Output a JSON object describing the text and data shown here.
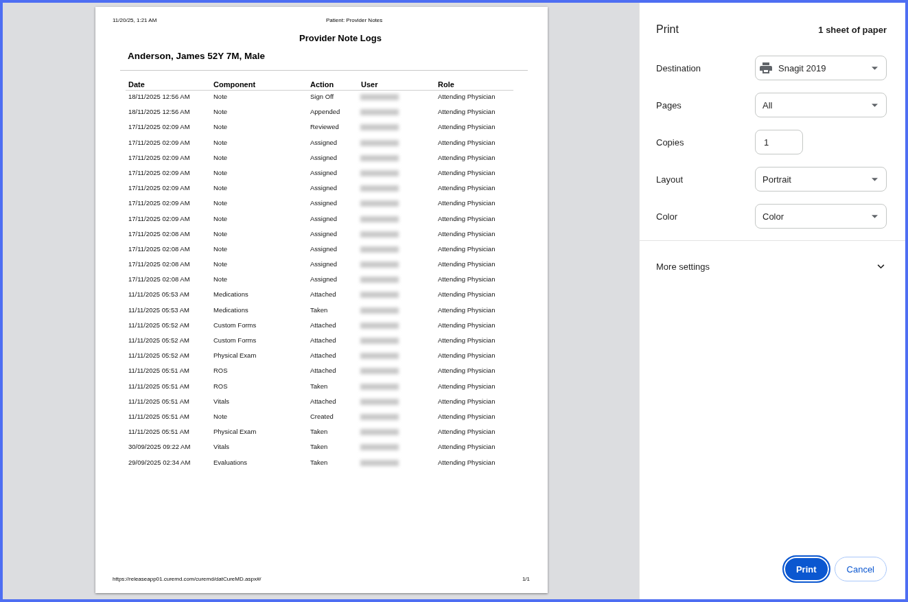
{
  "print_preview": {
    "page": {
      "header_date": "11/20/25, 1:21 AM",
      "header_title": "Patient: Provider Notes",
      "title": "Provider Note Logs",
      "patient": "Anderson, James 52Y 7M, Male",
      "table": {
        "columns": [
          "Date",
          "Component",
          "Action",
          "User",
          "Role"
        ],
        "rows": [
          {
            "date": "18/11/2025 12:56 AM",
            "component": "Note",
            "action": "Sign Off",
            "role": "Attending Physician"
          },
          {
            "date": "18/11/2025 12:56 AM",
            "component": "Note",
            "action": "Appended",
            "role": "Attending Physician"
          },
          {
            "date": "17/11/2025 02:09 AM",
            "component": "Note",
            "action": "Reviewed",
            "role": "Attending Physician"
          },
          {
            "date": "17/11/2025 02:09 AM",
            "component": "Note",
            "action": "Assigned",
            "role": "Attending Physician"
          },
          {
            "date": "17/11/2025 02:09 AM",
            "component": "Note",
            "action": "Assigned",
            "role": "Attending Physician"
          },
          {
            "date": "17/11/2025 02:09 AM",
            "component": "Note",
            "action": "Assigned",
            "role": "Attending Physician"
          },
          {
            "date": "17/11/2025 02:09 AM",
            "component": "Note",
            "action": "Assigned",
            "role": "Attending Physician"
          },
          {
            "date": "17/11/2025 02:09 AM",
            "component": "Note",
            "action": "Assigned",
            "role": "Attending Physician"
          },
          {
            "date": "17/11/2025 02:09 AM",
            "component": "Note",
            "action": "Assigned",
            "role": "Attending Physician"
          },
          {
            "date": "17/11/2025 02:08 AM",
            "component": "Note",
            "action": "Assigned",
            "role": "Attending Physician"
          },
          {
            "date": "17/11/2025 02:08 AM",
            "component": "Note",
            "action": "Assigned",
            "role": "Attending Physician"
          },
          {
            "date": "17/11/2025 02:08 AM",
            "component": "Note",
            "action": "Assigned",
            "role": "Attending Physician"
          },
          {
            "date": "17/11/2025 02:08 AM",
            "component": "Note",
            "action": "Assigned",
            "role": "Attending Physician"
          },
          {
            "date": "11/11/2025 05:53 AM",
            "component": "Medications",
            "action": "Attached",
            "role": "Attending Physician"
          },
          {
            "date": "11/11/2025 05:53 AM",
            "component": "Medications",
            "action": "Taken",
            "role": "Attending Physician"
          },
          {
            "date": "11/11/2025 05:52 AM",
            "component": "Custom Forms",
            "action": "Attached",
            "role": "Attending Physician"
          },
          {
            "date": "11/11/2025 05:52 AM",
            "component": "Custom Forms",
            "action": "Attached",
            "role": "Attending Physician"
          },
          {
            "date": "11/11/2025 05:52 AM",
            "component": "Physical Exam",
            "action": "Attached",
            "role": "Attending Physician"
          },
          {
            "date": "11/11/2025 05:51 AM",
            "component": "ROS",
            "action": "Attached",
            "role": "Attending Physician"
          },
          {
            "date": "11/11/2025 05:51 AM",
            "component": "ROS",
            "action": "Taken",
            "role": "Attending Physician"
          },
          {
            "date": "11/11/2025 05:51 AM",
            "component": "Vitals",
            "action": "Attached",
            "role": "Attending Physician"
          },
          {
            "date": "11/11/2025 05:51 AM",
            "component": "Note",
            "action": "Created",
            "role": "Attending Physician"
          },
          {
            "date": "11/11/2025 05:51 AM",
            "component": "Physical Exam",
            "action": "Taken",
            "role": "Attending Physician"
          },
          {
            "date": "30/09/2025 09:22 AM",
            "component": "Vitals",
            "action": "Taken",
            "role": "Attending Physician"
          },
          {
            "date": "29/09/2025 02:34 AM",
            "component": "Evaluations",
            "action": "Taken",
            "role": "Attending Physician"
          }
        ]
      },
      "footer_url": "https://releaseapp01.curemd.com/curemd/datCureMD.aspx#/",
      "page_number": "1/1"
    }
  },
  "print_panel": {
    "title": "Print",
    "sheet_count": "1 sheet of paper",
    "settings": [
      {
        "label": "Destination",
        "kind": "destination",
        "value": "Snagit 2019"
      },
      {
        "label": "Pages",
        "kind": "select",
        "value": "All"
      },
      {
        "label": "Copies",
        "kind": "number",
        "value": "1"
      },
      {
        "label": "Layout",
        "kind": "select",
        "value": "Portrait"
      },
      {
        "label": "Color",
        "kind": "select",
        "value": "Color"
      }
    ],
    "more_settings": {
      "label": "More settings",
      "expanded": false
    },
    "buttons": [
      {
        "label": "Print",
        "kind": "primary",
        "focused": true
      },
      {
        "label": "Cancel",
        "kind": "secondary",
        "focused": false
      }
    ]
  }
}
